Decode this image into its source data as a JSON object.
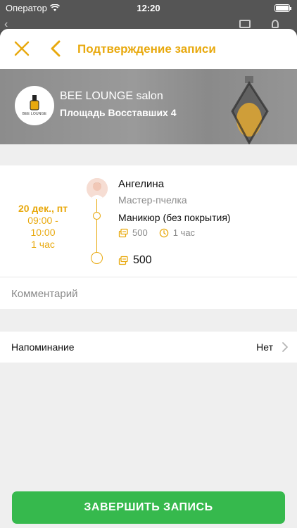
{
  "status_bar": {
    "carrier": "Оператор",
    "time": "12:20"
  },
  "header": {
    "title": "Подтверждение записи"
  },
  "salon": {
    "logo_text": "BEE LOUNGE",
    "name": "BEE LOUNGE salon",
    "address": "Площадь Восставших 4"
  },
  "appointment": {
    "date": "20 дек., пт",
    "time_range": "09:00 -",
    "time_end": "10:00",
    "duration": "1 час",
    "master_name": "Ангелина",
    "master_role": "Мастер-пчелка",
    "service_name": "Маникюр (без покрытия)",
    "service_price": "500",
    "service_duration": "1 час",
    "total": "500"
  },
  "comment": {
    "placeholder": "Комментарий"
  },
  "reminder": {
    "label": "Напоминание",
    "value": "Нет"
  },
  "finish_button": {
    "label": "ЗАВЕРШИТЬ ЗАПИСЬ"
  },
  "colors": {
    "accent": "#e8a90e",
    "button": "#36b94d"
  }
}
